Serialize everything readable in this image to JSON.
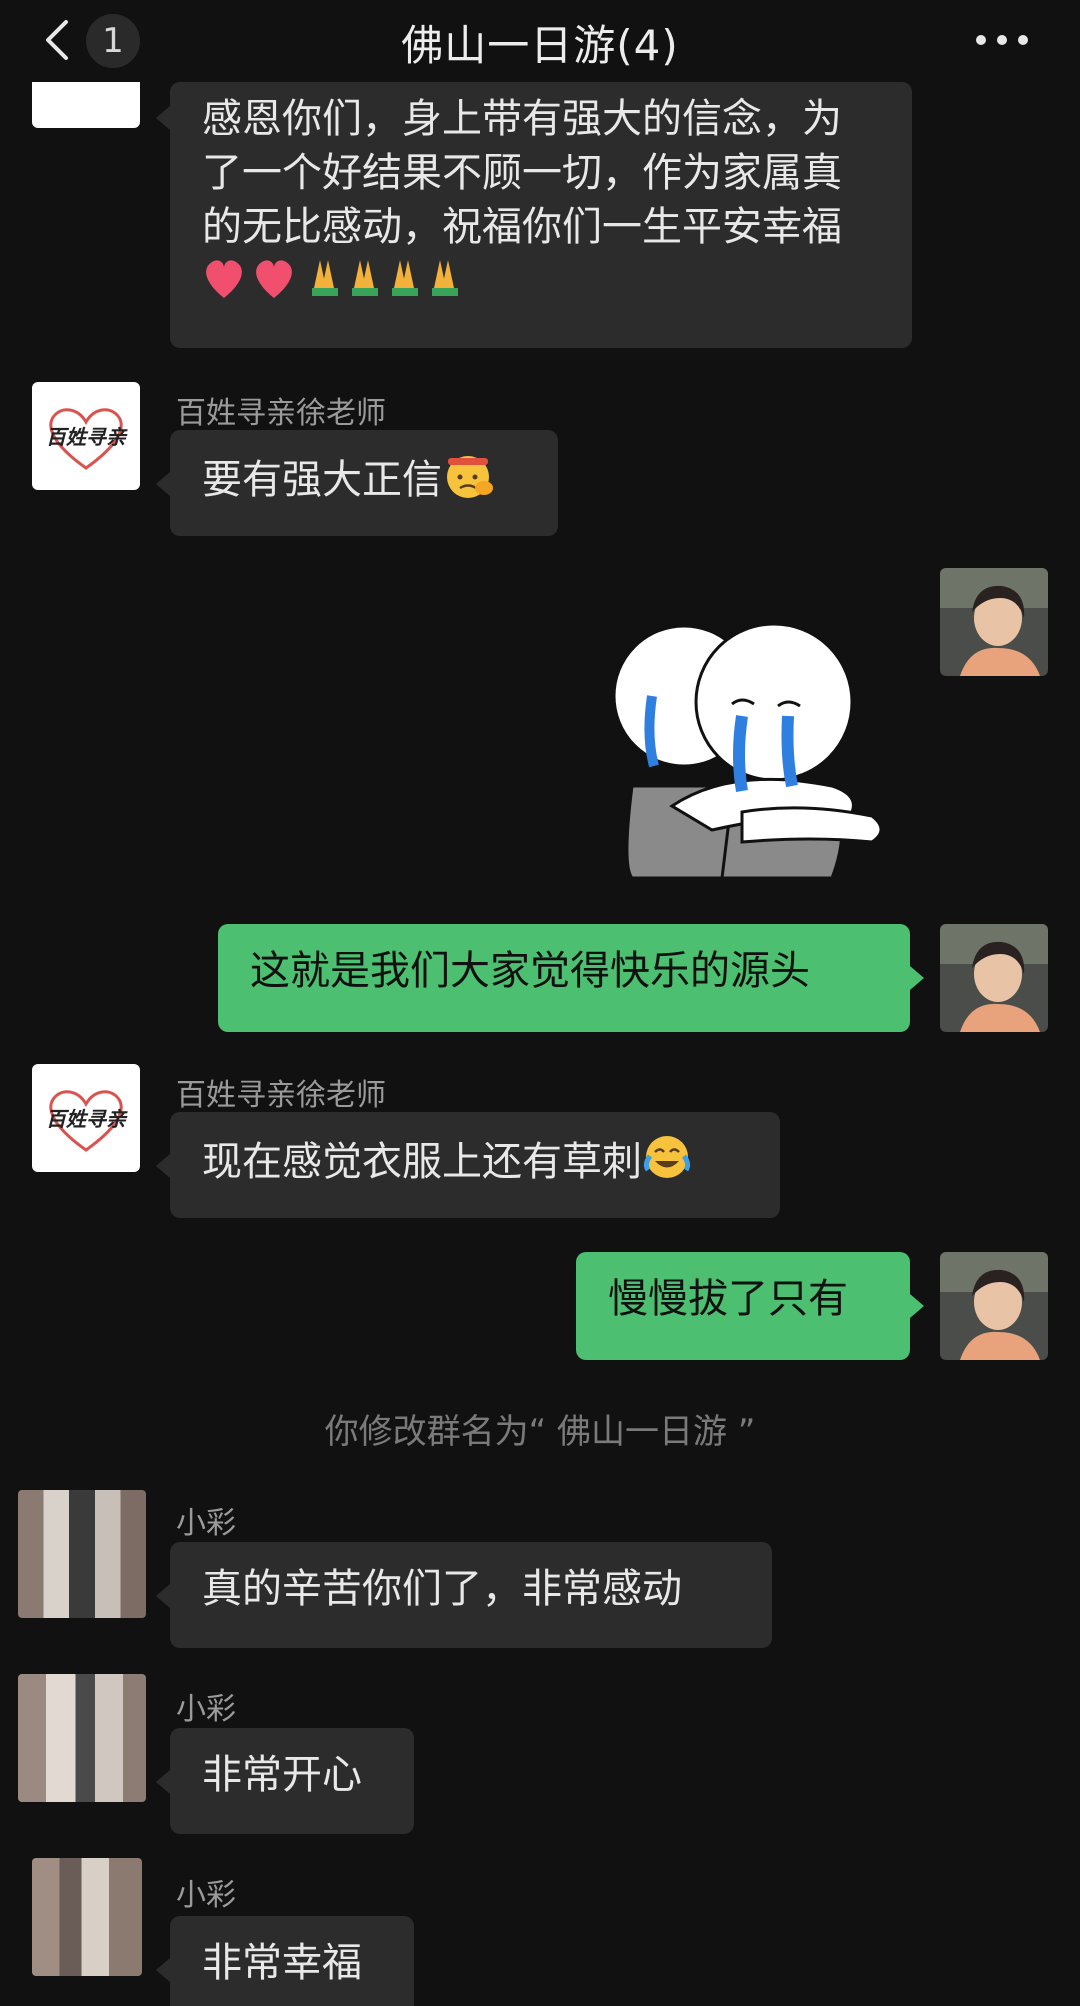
{
  "header": {
    "title": "佛山一日游(4)",
    "unread_count": "1"
  },
  "messages": {
    "m1": {
      "text": "感恩你们，身上带有强大的信念，为了一个好结果不顾一切，作为家属真的无比感动，祝福你们一生平安幸福",
      "emoji_name": "hearts-and-praying-hands-emoji"
    },
    "m2": {
      "sender": "百姓寻亲徐老师",
      "text": "要有强大正信",
      "emoji_name": "saluting-face-emoji"
    },
    "m3": {
      "sticker_name": "crying-hug-sticker"
    },
    "m4": {
      "text": "这就是我们大家觉得快乐的源头"
    },
    "m5": {
      "sender": "百姓寻亲徐老师",
      "text": "现在感觉衣服上还有草刺",
      "emoji_name": "face-with-tears-of-joy-emoji"
    },
    "m6": {
      "text": "慢慢拔了只有"
    },
    "system": {
      "text": "你修改群名为“ 佛山一日游 ”"
    },
    "m7": {
      "sender": "小彩",
      "text": "真的辛苦你们了，非常感动"
    },
    "m8": {
      "sender": "小彩",
      "text": "非常开心"
    },
    "m9": {
      "sender": "小彩",
      "text": "非常幸福"
    }
  },
  "logo": {
    "text": "百姓寻亲"
  },
  "colors": {
    "background": "#111111",
    "bubble_received": "#2c2c2c",
    "bubble_sent": "#4cbf71",
    "sender_name": "#9a9a9a",
    "system_text": "#7a7a7a"
  }
}
